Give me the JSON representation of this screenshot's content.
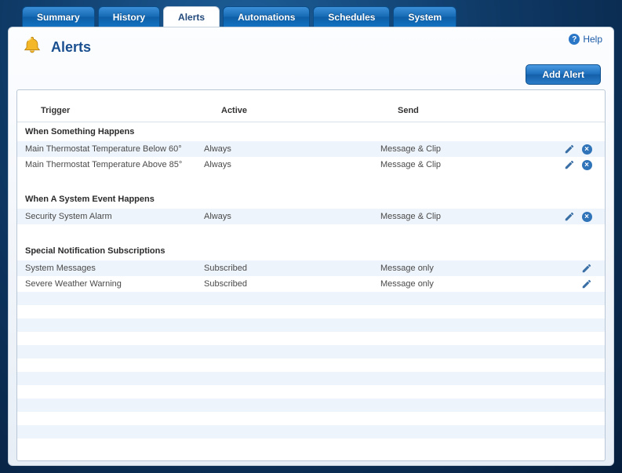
{
  "tabs": [
    {
      "label": "Summary",
      "active": false
    },
    {
      "label": "History",
      "active": false
    },
    {
      "label": "Alerts",
      "active": true
    },
    {
      "label": "Automations",
      "active": false
    },
    {
      "label": "Schedules",
      "active": false
    },
    {
      "label": "System",
      "active": false
    }
  ],
  "help_label": "Help",
  "page_title": "Alerts",
  "add_button": "Add Alert",
  "columns": {
    "trigger": "Trigger",
    "active": "Active",
    "send": "Send"
  },
  "sections": [
    {
      "title": "When Something Happens",
      "rows": [
        {
          "trigger": "Main Thermostat Temperature Below 60°",
          "active": "Always",
          "send": "Message & Clip",
          "can_delete": true
        },
        {
          "trigger": "Main Thermostat Temperature Above 85°",
          "active": "Always",
          "send": "Message & Clip",
          "can_delete": true
        }
      ]
    },
    {
      "title": "When A System Event Happens",
      "rows": [
        {
          "trigger": "Security System Alarm",
          "active": "Always",
          "send": "Message & Clip",
          "can_delete": true
        }
      ]
    },
    {
      "title": "Special Notification Subscriptions",
      "rows": [
        {
          "trigger": "System Messages",
          "active": "Subscribed",
          "send": "Message only",
          "can_delete": false
        },
        {
          "trigger": "Severe Weather Warning",
          "active": "Subscribed",
          "send": "Message only",
          "can_delete": false
        }
      ]
    }
  ]
}
